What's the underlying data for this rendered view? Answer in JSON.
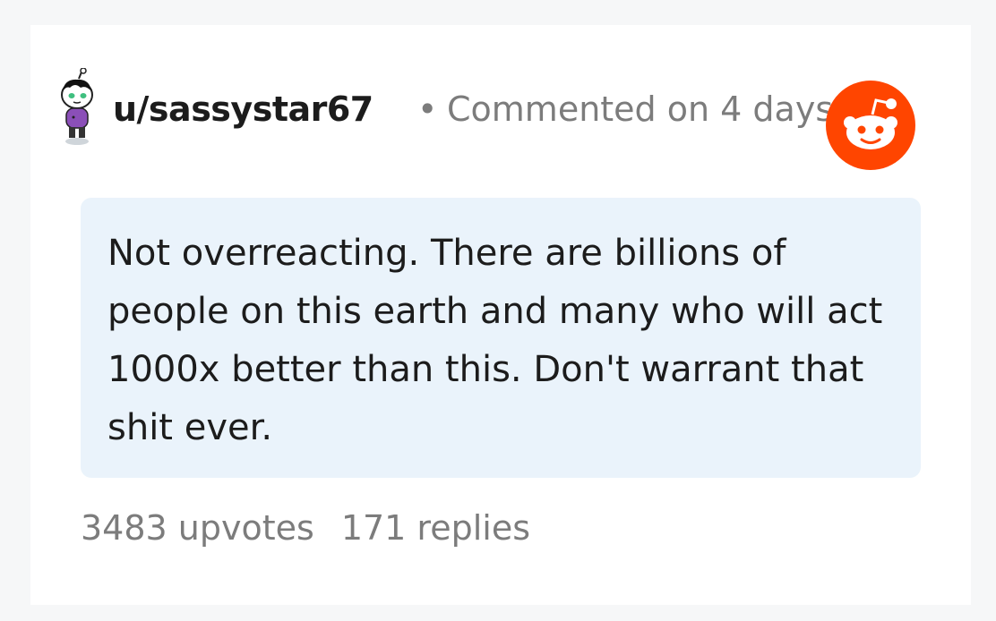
{
  "comment": {
    "username": "u/sassystar67",
    "separator": "•",
    "timestamp": "Commented on 4 days ago",
    "body": "Not overreacting. There are billions of people on this earth and many who will act 1000x better than this. Don't warrant that shit ever.",
    "upvotes": "3483 upvotes",
    "replies": "171 replies"
  },
  "icons": {
    "avatar": "user-avatar-icon",
    "brand": "reddit-logo-icon"
  },
  "colors": {
    "reddit_orange": "#ff4500",
    "body_bg": "#eaf3fb",
    "muted_text": "#7c7c7c",
    "primary_text": "#1c1c1c"
  }
}
